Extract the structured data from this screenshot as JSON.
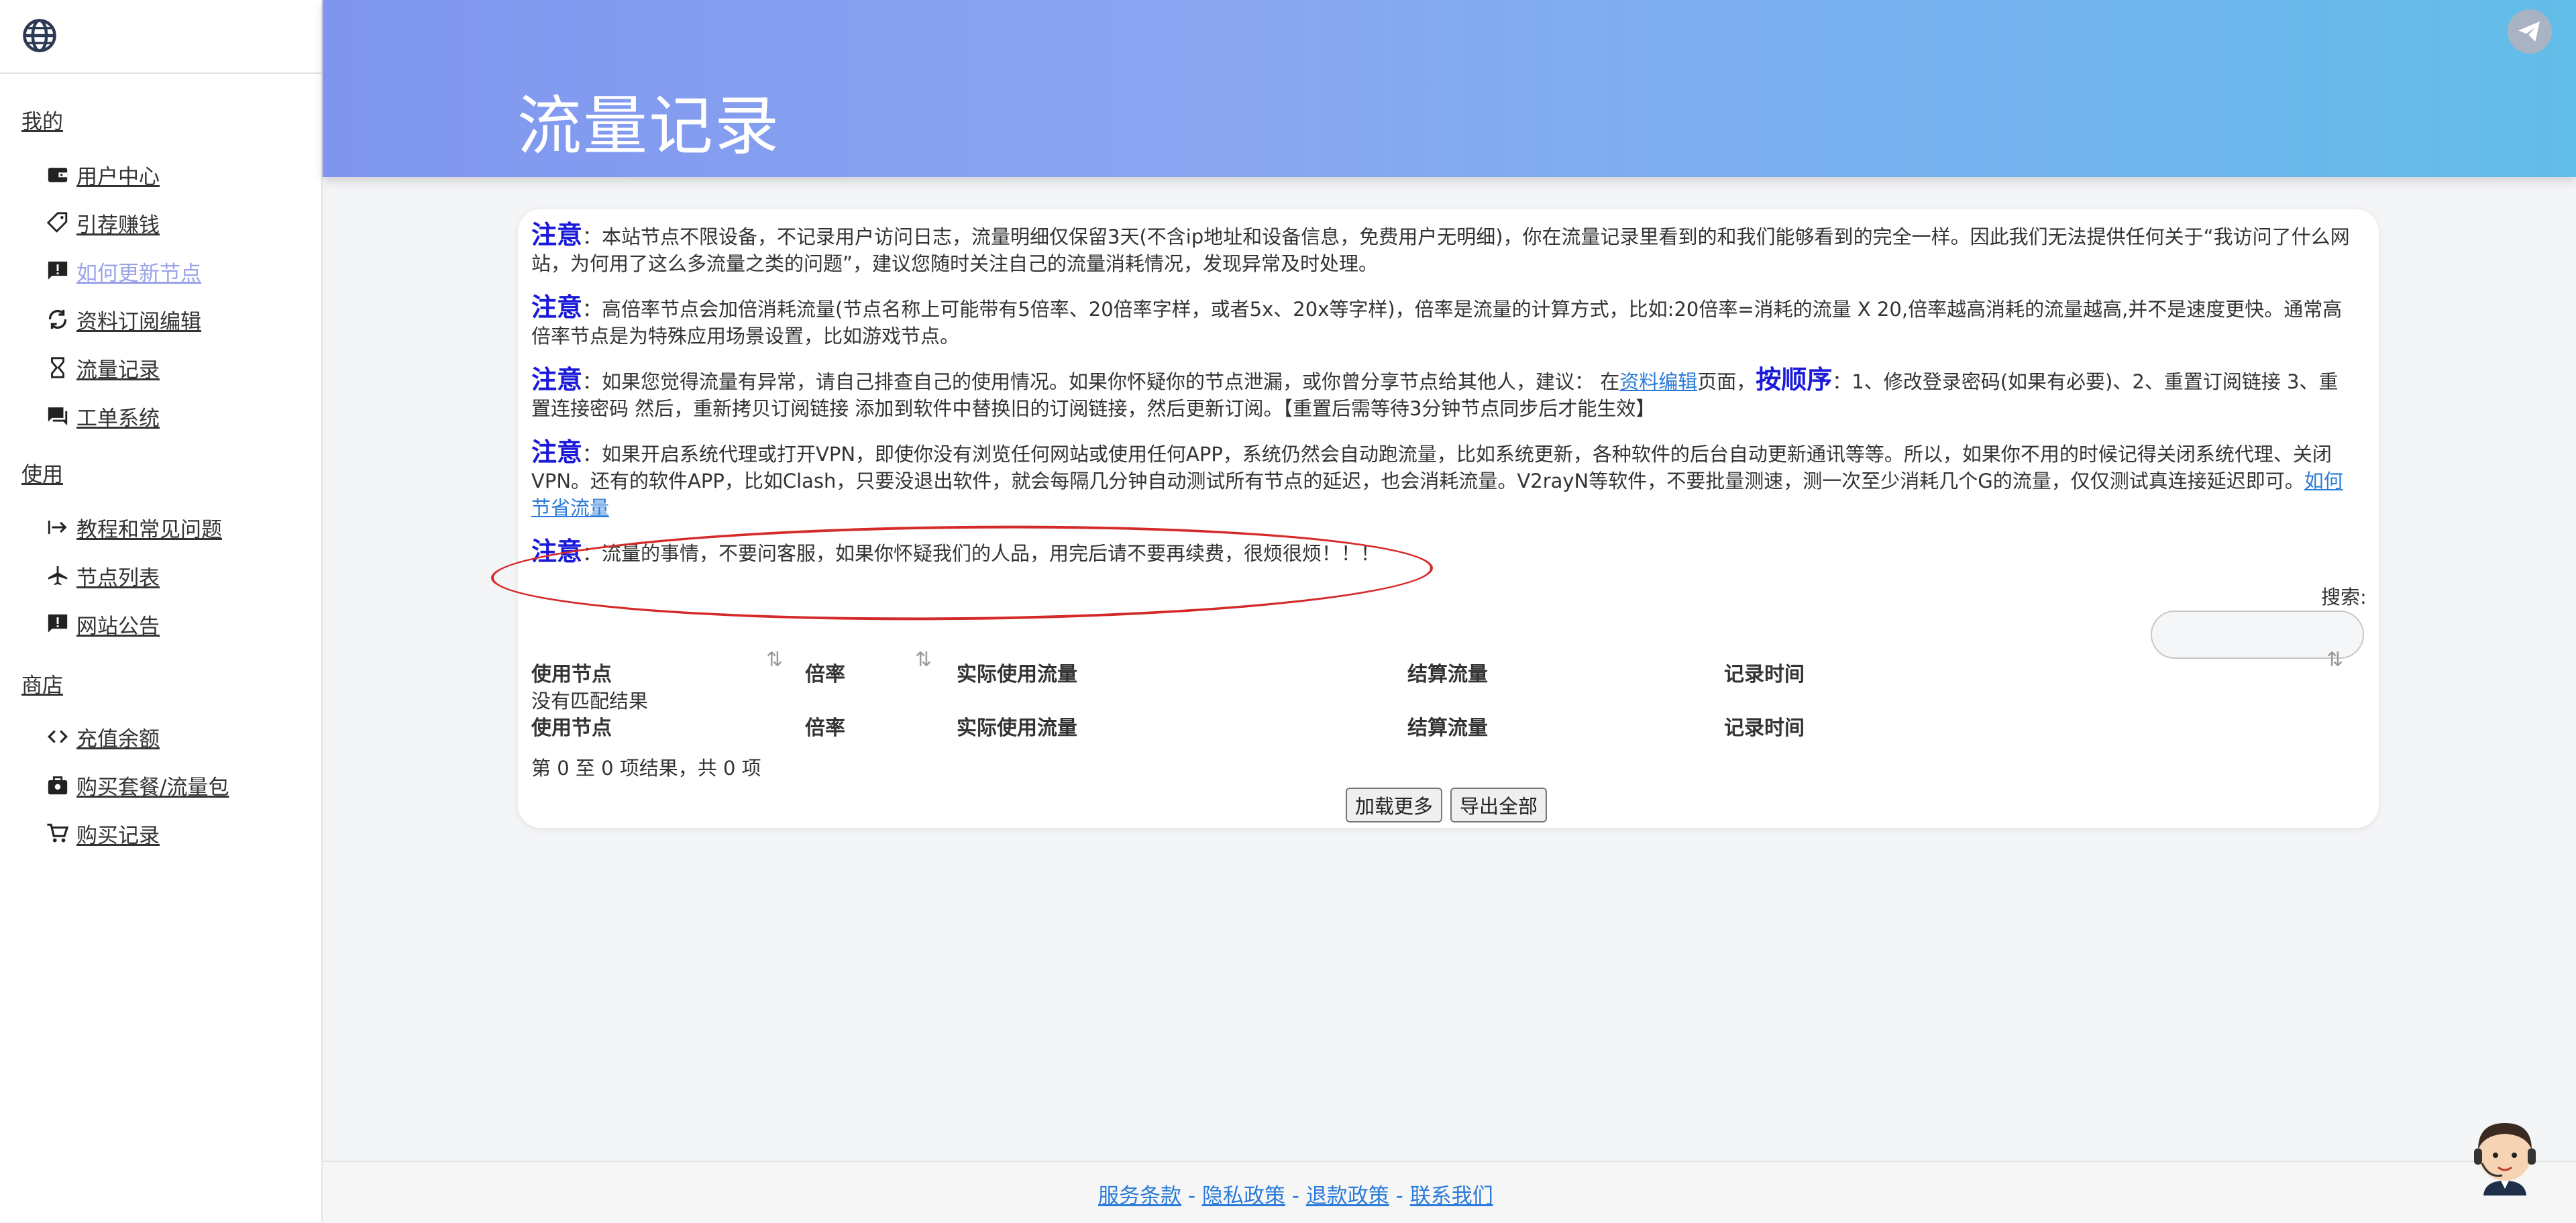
{
  "sidebar": {
    "sections": [
      {
        "label": "我的"
      },
      {
        "label": "使用"
      },
      {
        "label": "商店"
      }
    ],
    "items": [
      {
        "label": "用户中心",
        "icon": "wallet-icon"
      },
      {
        "label": "引荐赚钱",
        "icon": "tag-icon"
      },
      {
        "label": "如何更新节点",
        "icon": "alert-chat-icon",
        "active": true
      },
      {
        "label": "资料订阅编辑",
        "icon": "sync-icon"
      },
      {
        "label": "流量记录",
        "icon": "hourglass-icon"
      },
      {
        "label": "工单系统",
        "icon": "chat-icon"
      },
      {
        "label": "教程和常见问题",
        "icon": "arrow-bar-icon"
      },
      {
        "label": "节点列表",
        "icon": "airplane-icon"
      },
      {
        "label": "网站公告",
        "icon": "alert-chat-icon"
      },
      {
        "label": "充值余额",
        "icon": "code-icon"
      },
      {
        "label": "购买套餐/流量包",
        "icon": "bag-icon"
      },
      {
        "label": "购买记录",
        "icon": "cart-icon"
      }
    ]
  },
  "header": {
    "title": "流量记录"
  },
  "notices": {
    "tag": "注意",
    "n1": "：本站节点不限设备，不记录用户访问日志，流量明细仅保留3天(不含ip地址和设备信息，免费用户无明细)，你在流量记录里看到的和我们能够看到的完全一样。因此我们无法提供任何关于“我访问了什么网站，为何用了这么多流量之类的问题”，建议您随时关注自己的流量消耗情况，发现异常及时处理。",
    "n2": "：高倍率节点会加倍消耗流量(节点名称上可能带有5倍率、20倍率字样，或者5x、20x等字样)，倍率是流量的计算方式，比如:20倍率=消耗的流量 X 20,倍率越高消耗的流量越高,并不是速度更快。通常高倍率节点是为特殊应用场景设置，比如游戏节点。",
    "n3a": "：如果您觉得流量有异常，请自己排查自己的使用情况。如果你怀疑你的节点泄漏，或你曾分享节点给其他人，建议：  在",
    "n3_link": "资料编辑",
    "n3b": "页面，",
    "n3_bold": "按顺序",
    "n3c": "：1、修改登录密码(如果有必要)、2、重置订阅链接 3、重置连接密码 然后，重新拷贝订阅链接 添加到软件中替换旧的订阅链接，然后更新订阅。【重置后需等待3分钟节点同步后才能生效】",
    "n4": "：如果开启系统代理或打开VPN，即使你没有浏览任何网站或使用任何APP，系统仍然会自动跑流量，比如系统更新，各种软件的后台自动更新通讯等等。所以，如果你不用的时候记得关闭系统代理、关闭VPN。还有的软件APP，比如Clash，只要没退出软件，就会每隔几分钟自动测试所有节点的延迟，也会消耗流量。V2rayN等软件，不要批量测速，测一次至少消耗几个G的流量，仅仅测试真连接延迟即可。",
    "n4_link": "如何节省流量",
    "n5": "：流量的事情，不要问客服，如果你怀疑我们的人品，用完后请不要再续费，很烦很烦！！！"
  },
  "table": {
    "search_label": "搜索:",
    "search_value": "",
    "columns": [
      "使用节点",
      "倍率",
      "实际使用流量",
      "结算流量",
      "记录时间"
    ],
    "empty_text": "没有匹配结果",
    "summary": "第 0 至 0 项结果，共 0 项",
    "load_more": "加载更多",
    "export_all": "导出全部"
  },
  "footer": {
    "links": [
      "服务条款",
      "隐私政策",
      "退款政策",
      "联系我们"
    ]
  },
  "colors": {
    "accent_blue": "#1a1ad8",
    "link_blue": "#2b7bd8",
    "active_item": "#9aa3e8",
    "highlight_red": "#d42a2a"
  }
}
